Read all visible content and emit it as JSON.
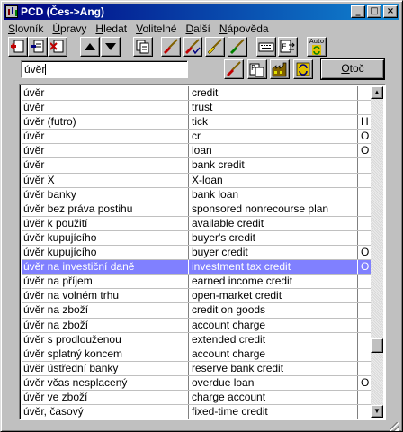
{
  "window": {
    "title": "PCD (Čes->Ang)",
    "buttons": {
      "minimize": "_",
      "maximize": "□",
      "close": "×"
    }
  },
  "menu": [
    {
      "accel": "S",
      "rest": "lovník"
    },
    {
      "accel": "Ú",
      "rest": "pravy"
    },
    {
      "accel": "H",
      "rest": "ledat"
    },
    {
      "accel": "V",
      "rest": "olitelné"
    },
    {
      "accel": "D",
      "rest": "alší"
    },
    {
      "accel": "N",
      "rest": "ápověda"
    }
  ],
  "toolbar": {
    "icons": [
      "new-entry-icon",
      "edit-entry-icon",
      "delete-entry-icon",
      "arrow-up-icon",
      "arrow-down-icon",
      "copy-entry-icon",
      "brush-red-icon",
      "brush-red-check-icon",
      "brush-yellow-icon",
      "brush-green-icon",
      "keyboard-icon",
      "exchange-icon",
      "auto-refresh-icon"
    ],
    "auto_label": "Auto"
  },
  "search": {
    "value": "úvěr"
  },
  "search_tools": [
    "brush-icon",
    "paste-icon",
    "factory-icon",
    "refresh-icon"
  ],
  "otoc_button": {
    "accel": "O",
    "rest": "toč"
  },
  "entries": [
    {
      "cz": "úvěr",
      "en": "credit",
      "flag": ""
    },
    {
      "cz": "úvěr",
      "en": "trust",
      "flag": ""
    },
    {
      "cz": "úvěr (futro)",
      "en": "tick",
      "flag": "H"
    },
    {
      "cz": "úvěr",
      "en": "cr",
      "flag": "O"
    },
    {
      "cz": "úvěr",
      "en": "loan",
      "flag": "O"
    },
    {
      "cz": "úvěr",
      "en": "bank credit",
      "flag": ""
    },
    {
      "cz": "úvěr X",
      "en": "X-loan",
      "flag": ""
    },
    {
      "cz": "úvěr banky",
      "en": "bank loan",
      "flag": ""
    },
    {
      "cz": "úvěr bez práva postihu",
      "en": "sponsored nonrecourse plan",
      "flag": ""
    },
    {
      "cz": "úvěr k použití",
      "en": "available credit",
      "flag": ""
    },
    {
      "cz": "úvěr kupujícího",
      "en": "buyer's credit",
      "flag": ""
    },
    {
      "cz": "úvěr kupujícího",
      "en": "buyer credit",
      "flag": "O"
    },
    {
      "cz": "úvěr na investiční daně",
      "en": "investment tax credit",
      "flag": "O",
      "selected": true
    },
    {
      "cz": "úvěr na příjem",
      "en": "earned income credit",
      "flag": ""
    },
    {
      "cz": "úvěr na volném trhu",
      "en": "open-market credit",
      "flag": ""
    },
    {
      "cz": "úvěr na zboží",
      "en": "credit on goods",
      "flag": ""
    },
    {
      "cz": "úvěr na zboží",
      "en": "account charge",
      "flag": ""
    },
    {
      "cz": "úvěr s prodlouženou",
      "en": "extended credit",
      "flag": ""
    },
    {
      "cz": "úvěr splatný koncem",
      "en": "account charge",
      "flag": ""
    },
    {
      "cz": "úvěr ústřední banky",
      "en": "reserve bank credit",
      "flag": ""
    },
    {
      "cz": "úvěr včas nesplacený",
      "en": "overdue loan",
      "flag": "O"
    },
    {
      "cz": "úvěr ve zboží",
      "en": "charge account",
      "flag": ""
    },
    {
      "cz": "úvěr, časový",
      "en": "fixed-time credit",
      "flag": ""
    }
  ],
  "scrollbar": {
    "up": "▲",
    "down": "▼"
  },
  "colors": {
    "titlebar": "#000080",
    "selection": "#8080ff",
    "face": "#c0c0c0"
  }
}
